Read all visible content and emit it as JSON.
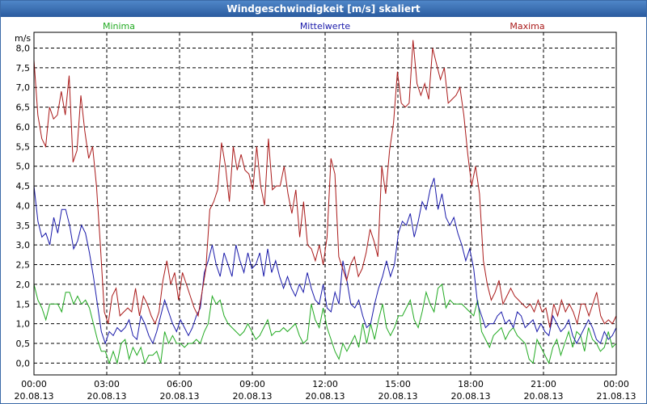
{
  "chart_data": {
    "type": "line",
    "title": "Windgeschwindigkeit [m/s] skaliert",
    "ylabel": "m/s",
    "xlabel": "",
    "ylim": [
      -0.3,
      8.4
    ],
    "xlim": [
      0,
      24
    ],
    "grid": true,
    "y_ticks": [
      "0,0",
      "0,5",
      "1,0",
      "1,5",
      "2,0",
      "2,5",
      "3,0",
      "3,5",
      "4,0",
      "4,5",
      "5,0",
      "5,5",
      "6,0",
      "6,5",
      "7,0",
      "7,5",
      "8,0"
    ],
    "x_ticks": [
      {
        "time": "00:00",
        "date": "20.08.13"
      },
      {
        "time": "03:00",
        "date": "20.08.13"
      },
      {
        "time": "06:00",
        "date": "20.08.13"
      },
      {
        "time": "09:00",
        "date": "20.08.13"
      },
      {
        "time": "12:00",
        "date": "20.08.13"
      },
      {
        "time": "15:00",
        "date": "20.08.13"
      },
      {
        "time": "18:00",
        "date": "20.08.13"
      },
      {
        "time": "21:00",
        "date": "20.08.13"
      },
      {
        "time": "00:00",
        "date": "21.08.13"
      }
    ],
    "series": [
      {
        "name": "Minima",
        "color": "#22aa22",
        "values": [
          2.0,
          1.6,
          1.4,
          1.1,
          1.5,
          1.5,
          1.5,
          1.3,
          1.8,
          1.8,
          1.5,
          1.7,
          1.5,
          1.6,
          1.4,
          1.0,
          0.6,
          0.3,
          0.3,
          0.0,
          0.3,
          0.0,
          0.5,
          0.6,
          0.1,
          0.4,
          0.2,
          0.4,
          0.0,
          0.2,
          0.2,
          0.3,
          0.0,
          0.8,
          0.5,
          0.7,
          0.5,
          0.5,
          0.4,
          0.5,
          0.5,
          0.6,
          0.5,
          0.8,
          1.0,
          1.7,
          1.5,
          1.6,
          1.2,
          1.0,
          0.9,
          0.8,
          0.7,
          0.8,
          1.0,
          0.8,
          0.6,
          0.7,
          0.9,
          1.1,
          0.7,
          0.8,
          0.8,
          0.9,
          0.8,
          0.9,
          1.0,
          0.7,
          0.5,
          0.6,
          1.5,
          1.1,
          0.9,
          1.4,
          0.9,
          0.6,
          0.3,
          0.1,
          0.5,
          0.3,
          0.5,
          0.7,
          0.4,
          1.0,
          0.5,
          1.0,
          0.6,
          1.1,
          1.5,
          0.9,
          0.7,
          0.9,
          1.2,
          1.2,
          1.4,
          1.6,
          1.1,
          0.9,
          1.3,
          1.8,
          1.5,
          1.3,
          1.9,
          2.0,
          1.4,
          1.6,
          1.5,
          1.5,
          1.5,
          1.4,
          1.3,
          1.2,
          1.6,
          0.8,
          0.6,
          0.4,
          0.7,
          0.8,
          0.9,
          0.6,
          0.8,
          0.9,
          0.7,
          0.6,
          0.5,
          0.1,
          0.0,
          0.6,
          0.4,
          0.2,
          0.0,
          0.4,
          0.6,
          0.2,
          0.5,
          0.8,
          0.4,
          0.8,
          0.7,
          0.3,
          0.9,
          0.6,
          0.5,
          0.3,
          0.4,
          0.8,
          0.4,
          0.5
        ]
      },
      {
        "name": "Mittelwerte",
        "color": "#1a1aaa",
        "values": [
          4.5,
          3.6,
          3.2,
          3.3,
          3.0,
          3.7,
          3.3,
          3.9,
          3.9,
          3.5,
          2.9,
          3.1,
          3.5,
          3.3,
          2.8,
          2.2,
          1.5,
          0.8,
          0.5,
          0.8,
          0.7,
          0.9,
          0.8,
          0.9,
          1.1,
          0.7,
          0.6,
          1.2,
          1.0,
          0.7,
          0.5,
          0.8,
          1.2,
          1.6,
          1.3,
          1.0,
          0.8,
          1.1,
          0.9,
          0.7,
          0.9,
          1.2,
          1.4,
          2.3,
          2.6,
          3.0,
          2.5,
          2.2,
          2.8,
          2.5,
          2.2,
          3.0,
          2.6,
          2.3,
          2.8,
          2.4,
          2.5,
          2.8,
          2.2,
          2.9,
          2.3,
          2.6,
          2.2,
          1.9,
          2.2,
          1.9,
          1.7,
          2.0,
          1.8,
          2.3,
          1.9,
          1.6,
          1.5,
          2.0,
          1.4,
          1.3,
          1.8,
          1.5,
          2.6,
          2.1,
          1.5,
          1.4,
          1.6,
          1.2,
          0.9,
          1.0,
          1.5,
          1.9,
          2.2,
          2.6,
          2.2,
          2.5,
          3.3,
          3.6,
          3.5,
          3.8,
          3.2,
          3.6,
          4.1,
          3.9,
          4.4,
          4.7,
          3.9,
          4.3,
          3.7,
          3.5,
          3.7,
          3.3,
          3.0,
          2.6,
          2.9,
          2.4,
          1.5,
          1.2,
          0.9,
          1.0,
          1.0,
          1.2,
          1.3,
          1.0,
          1.1,
          0.9,
          1.3,
          1.2,
          0.9,
          1.0,
          1.1,
          0.8,
          1.0,
          0.8,
          0.7,
          1.2,
          1.0,
          0.8,
          0.9,
          1.1,
          0.7,
          0.5,
          0.7,
          0.9,
          1.1,
          0.9,
          0.6,
          0.5,
          0.8,
          0.6,
          0.7,
          0.9
        ]
      },
      {
        "name": "Maxima",
        "color": "#aa1a1a",
        "values": [
          7.7,
          6.3,
          5.7,
          5.5,
          6.5,
          6.2,
          6.3,
          6.9,
          6.3,
          7.3,
          5.1,
          5.4,
          6.8,
          5.9,
          5.2,
          5.5,
          4.5,
          3.0,
          1.3,
          1.0,
          1.7,
          1.9,
          1.2,
          1.3,
          1.4,
          1.3,
          1.9,
          1.2,
          1.7,
          1.5,
          1.2,
          1.0,
          1.3,
          2.1,
          2.6,
          2.0,
          2.3,
          1.6,
          2.3,
          2.0,
          1.7,
          1.4,
          1.2,
          1.8,
          2.4,
          3.9,
          4.1,
          4.4,
          5.6,
          5.0,
          4.1,
          5.5,
          4.9,
          5.3,
          4.9,
          4.8,
          4.4,
          5.5,
          4.5,
          4.0,
          5.7,
          4.4,
          4.5,
          4.5,
          5.0,
          4.3,
          3.8,
          4.4,
          3.2,
          4.1,
          3.0,
          2.9,
          2.6,
          3.0,
          2.5,
          3.2,
          5.2,
          4.8,
          2.7,
          2.4,
          2.1,
          2.5,
          2.7,
          2.2,
          2.4,
          2.8,
          3.4,
          3.1,
          2.7,
          5.0,
          4.3,
          5.4,
          6.1,
          7.4,
          6.6,
          6.5,
          6.6,
          8.2,
          7.1,
          6.8,
          7.1,
          6.7,
          8.0,
          7.6,
          7.2,
          7.5,
          6.6,
          6.7,
          6.8,
          7.0,
          6.3,
          5.3,
          4.5,
          5.0,
          4.3,
          2.6,
          2.0,
          1.6,
          1.8,
          2.1,
          1.5,
          1.7,
          1.9,
          1.7,
          1.6,
          1.5,
          1.4,
          1.5,
          1.3,
          1.6,
          1.3,
          1.4,
          0.9,
          1.5,
          1.2,
          1.6,
          1.3,
          1.5,
          1.3,
          1.0,
          1.5,
          1.5,
          1.2,
          1.5,
          1.8,
          1.2,
          1.0,
          1.1,
          1.0,
          1.2
        ]
      }
    ]
  }
}
